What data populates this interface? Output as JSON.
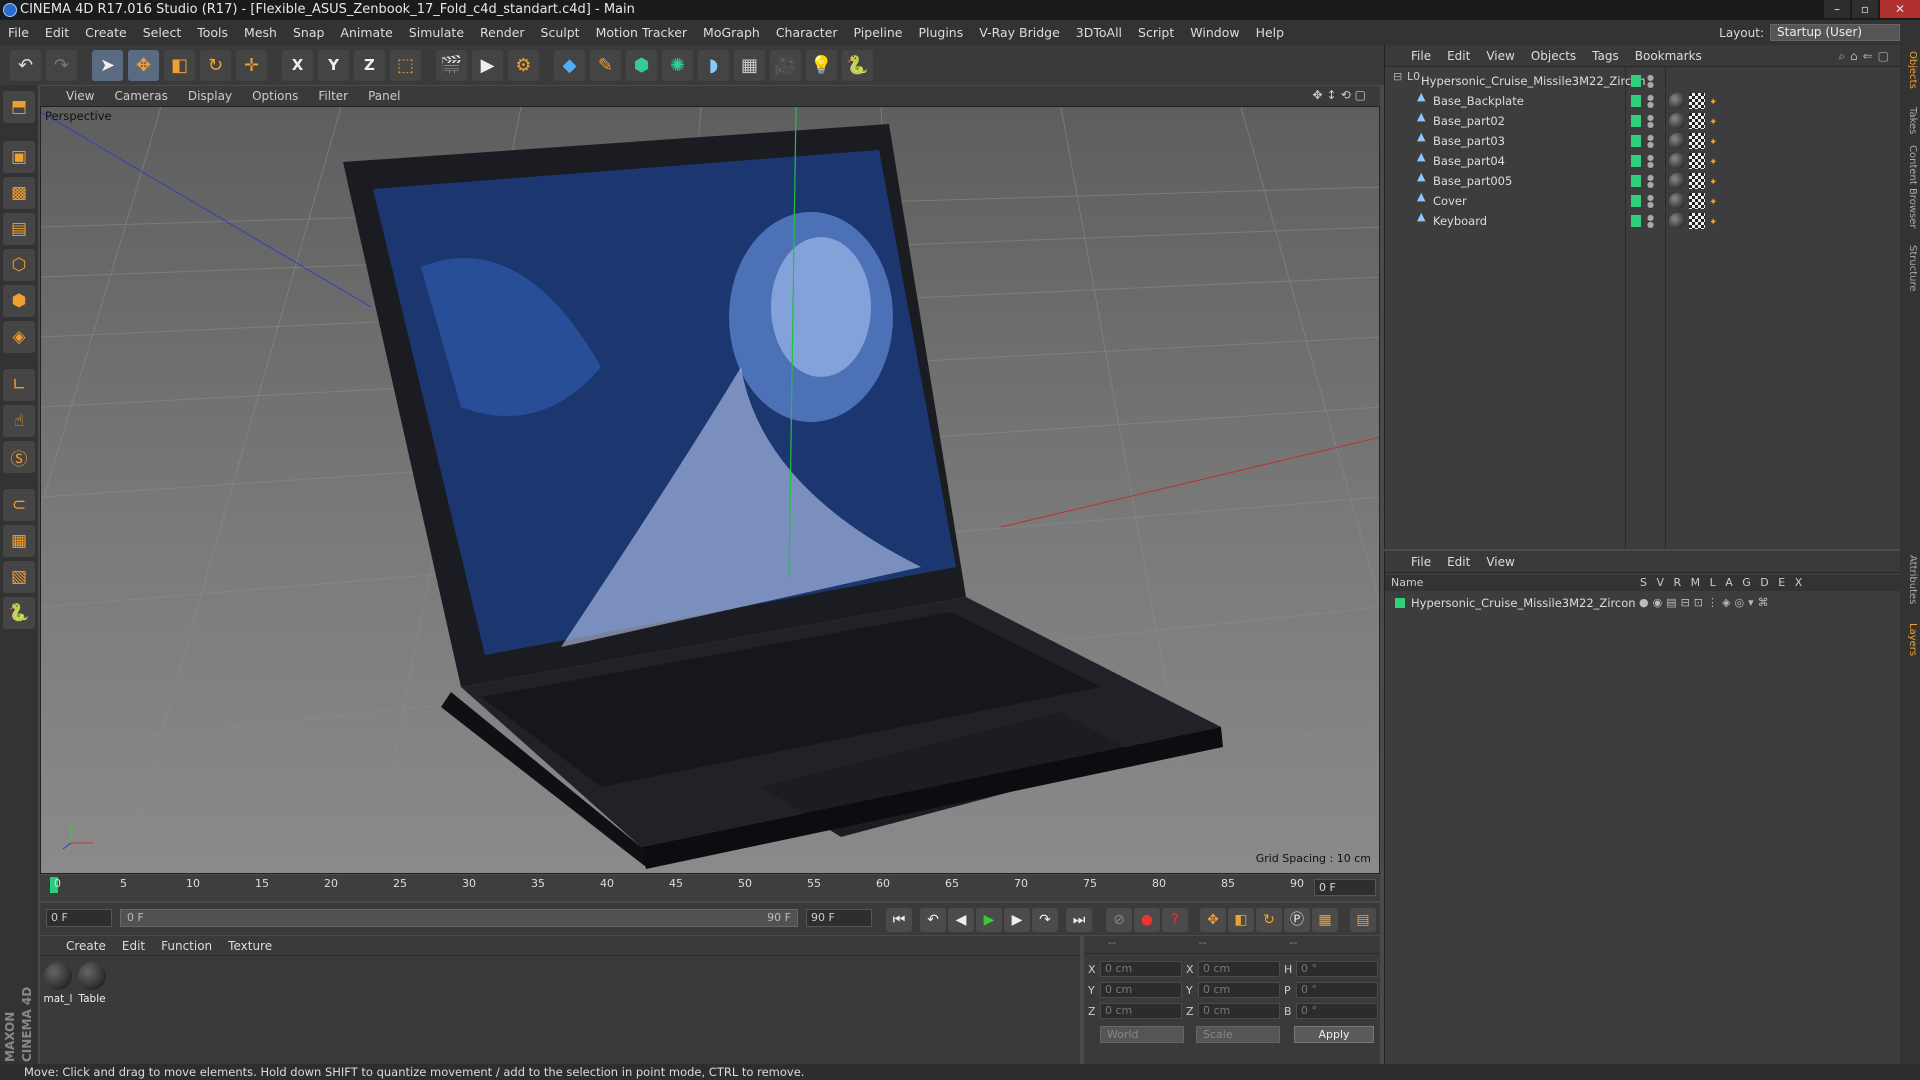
{
  "window": {
    "title": "CINEMA 4D R17.016 Studio (R17) - [Flexible_ASUS_Zenbook_17_Fold_c4d_standart.c4d] - Main"
  },
  "menu": [
    "File",
    "Edit",
    "Create",
    "Select",
    "Tools",
    "Mesh",
    "Snap",
    "Animate",
    "Simulate",
    "Render",
    "Sculpt",
    "Motion Tracker",
    "MoGraph",
    "Character",
    "Pipeline",
    "Plugins",
    "V-Ray Bridge",
    "3DToAll",
    "Script",
    "Window",
    "Help"
  ],
  "layout": {
    "label": "Layout:",
    "value": "Startup (User)"
  },
  "toolbar": {
    "axis_x": "X",
    "axis_y": "Y",
    "axis_z": "Z"
  },
  "viewport": {
    "menu": [
      "View",
      "Cameras",
      "Display",
      "Options",
      "Filter",
      "Panel"
    ],
    "camera_label": "Perspective",
    "grid_spacing": "Grid Spacing : 10 cm"
  },
  "timeline": {
    "ticks": [
      "0",
      "5",
      "10",
      "15",
      "20",
      "25",
      "30",
      "35",
      "40",
      "45",
      "50",
      "55",
      "60",
      "65",
      "70",
      "75",
      "80",
      "85",
      "90"
    ],
    "current_frame": "0 F"
  },
  "transport": {
    "start": "0 F",
    "range_start": "0 F",
    "range_end": "90 F",
    "end": "90 F"
  },
  "materials": {
    "menu": [
      "Create",
      "Edit",
      "Function",
      "Texture"
    ],
    "items": [
      {
        "label": "mat_l"
      },
      {
        "label": "Table"
      }
    ]
  },
  "coords": {
    "headers": [
      "--",
      "--",
      "--"
    ],
    "rows": [
      {
        "a": "X",
        "av": "0 cm",
        "b": "X",
        "bv": "0 cm",
        "c": "H",
        "cv": "0 °"
      },
      {
        "a": "Y",
        "av": "0 cm",
        "b": "Y",
        "bv": "0 cm",
        "c": "P",
        "cv": "0 °"
      },
      {
        "a": "Z",
        "av": "0 cm",
        "b": "Z",
        "bv": "0 cm",
        "c": "B",
        "cv": "0 °"
      }
    ],
    "space": "World",
    "mode": "Scale",
    "apply": "Apply"
  },
  "brand": "MAXON CINEMA 4D",
  "status": "Move: Click and drag to move elements. Hold down SHIFT to quantize movement / add to the selection in point mode, CTRL to remove.",
  "objects": {
    "menu": [
      "File",
      "Edit",
      "View",
      "Objects",
      "Tags",
      "Bookmarks"
    ],
    "root": "Hypersonic_Cruise_Missile3M22_Zircon",
    "children": [
      "Base_Backplate",
      "Base_part02",
      "Base_part03",
      "Base_part04",
      "Base_part005",
      "Cover",
      "Keyboard"
    ]
  },
  "layers": {
    "menu": [
      "File",
      "Edit",
      "View"
    ],
    "columns": {
      "name": "Name",
      "flags": "S V R M L A G D E X"
    },
    "row": "Hypersonic_Cruise_Missile3M22_Zircon"
  },
  "side_tabs": [
    "Objects",
    "Takes",
    "Content Browser",
    "Structure",
    "Attributes",
    "Layers"
  ],
  "colors": {
    "accent_green": "#2fd07a",
    "accent_orange": "#f0a030",
    "bg": "#4a4a4a"
  }
}
